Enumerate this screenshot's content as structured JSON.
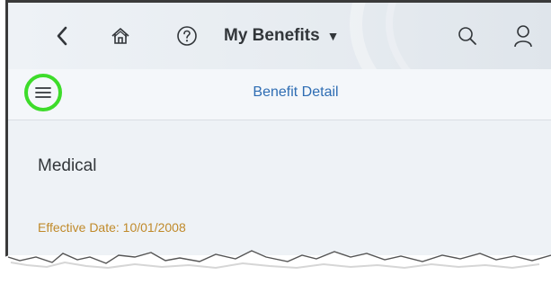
{
  "header": {
    "back_icon": "chevron-left-icon",
    "home_icon": "home-icon",
    "help_icon": "help-circle-icon",
    "title": "My Benefits",
    "title_caret": "▼",
    "search_icon": "search-icon",
    "user_icon": "user-icon"
  },
  "subbar": {
    "menu_icon": "hamburger-menu-icon",
    "title": "Benefit Detail"
  },
  "content": {
    "section_title": "Medical",
    "effective_date": "Effective Date: 10/01/2008"
  },
  "colors": {
    "highlight_ring": "#3ddc2a",
    "link_blue": "#2e6db3",
    "date_gold": "#c08a2a"
  }
}
